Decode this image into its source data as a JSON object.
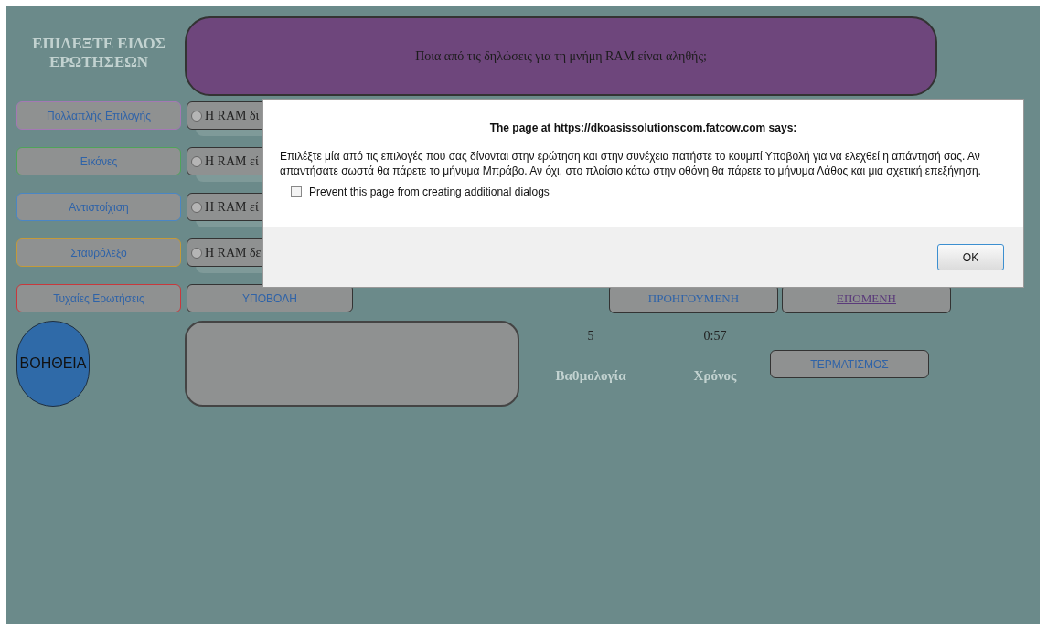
{
  "heading": "ΕΠΙΛΕΞΤΕ ΕΙΔΟΣ ΕΡΩΤΗΣΕΩΝ",
  "question": "Ποια από τις δηλώσεις για τη μνήμη RAM είναι αληθής;",
  "categories": [
    {
      "label": "Πολλαπλής Επιλογής",
      "color": "#a478b4"
    },
    {
      "label": "Εικόνες",
      "color": "#4fa35a"
    },
    {
      "label": "Αντιστοίχιση",
      "color": "#4a86c4"
    },
    {
      "label": "Σταυρόλεξο",
      "color": "#c49a3a"
    },
    {
      "label": "Τυχαίες Ερωτήσεις",
      "color": "#c8383c"
    }
  ],
  "answers": [
    {
      "text": "Η RAM δι",
      "selected": false
    },
    {
      "text": "Η RAM εί",
      "selected": false
    },
    {
      "text": "Η RAM εί",
      "selected": false
    },
    {
      "text": "Η RAM δε",
      "selected": false
    }
  ],
  "submit": "ΥΠΟΒΟΛΗ",
  "nav": [
    {
      "label": "ΠΡΟΗΓΟΥΜΕΝΗ",
      "underlined": false
    },
    {
      "label": "ΕΠΟΜΕΝΗ",
      "underlined": true
    }
  ],
  "help": "ΒΟΗΘΕΙΑ",
  "score": {
    "value": "5",
    "label": "Βαθμολογία"
  },
  "time": {
    "value": "0:57",
    "label": "Χρόνος"
  },
  "finish": "ΤΕΡΜΑΤΙΣΜΟΣ",
  "dialog": {
    "title": "The page at https://dkoasissolutionscom.fatcow.com says:",
    "message": "Επιλέξτε μία από τις επιλογές που σας δίνονται στην ερώτηση και στην συνέχεια πατήστε το κουμπί Υποβολή για να ελεχθεί η απάντησή σας. Αν απαντήσατε σωστά θα πάρετε το μήνυμα Μπράβο. Αν όχι, στο πλαίσιο κάτω στην οθόνη θα πάρετε το μήνυμα Λάθος και μια σχετική επεξήγηση.",
    "checkbox": {
      "label": "Prevent this page from creating additional dialogs",
      "checked": false
    },
    "button": "OK"
  }
}
